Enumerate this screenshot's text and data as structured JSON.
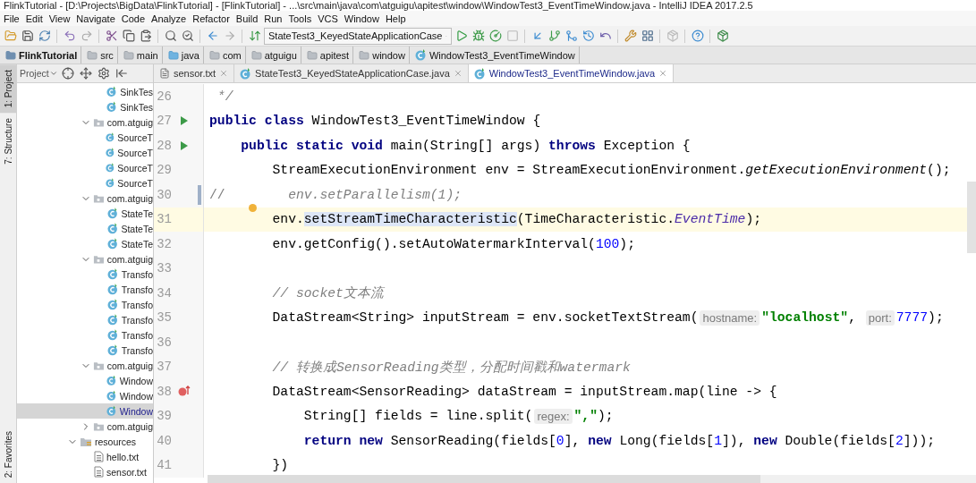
{
  "window": {
    "title": "FlinkTutorial - [D:\\Projects\\BigData\\FlinkTutorial] - [FlinkTutorial] - ...\\src\\main\\java\\com\\atguigu\\apitest\\window\\WindowTest3_EventTimeWindow.java - IntelliJ IDEA 2017.2.5"
  },
  "menu": [
    "File",
    "Edit",
    "View",
    "Navigate",
    "Code",
    "Analyze",
    "Refactor",
    "Build",
    "Run",
    "Tools",
    "VCS",
    "Window",
    "Help"
  ],
  "toolbar": {
    "run_config": "StateTest3_KeyedStateApplicationCase"
  },
  "breadcrumbs": [
    {
      "kind": "project",
      "label": "FlinkTutorial"
    },
    {
      "kind": "folder",
      "label": "src"
    },
    {
      "kind": "folder",
      "label": "main"
    },
    {
      "kind": "source",
      "label": "java"
    },
    {
      "kind": "package",
      "label": "com"
    },
    {
      "kind": "package",
      "label": "atguigu"
    },
    {
      "kind": "package",
      "label": "apitest"
    },
    {
      "kind": "package",
      "label": "window"
    },
    {
      "kind": "class",
      "label": "WindowTest3_EventTimeWindow"
    }
  ],
  "tool_tabs": {
    "top": [
      {
        "label": "1: Project",
        "selected": true
      },
      {
        "label": "7: Structure",
        "selected": false
      }
    ],
    "bottom": [
      {
        "label": "2: Favorites",
        "selected": false
      }
    ]
  },
  "project_panel": {
    "title": "Project"
  },
  "tree": [
    {
      "children": [
        {
          "children": [
            {
              "kind": "class",
              "label": "SinkTes",
              "selected": false
            },
            {
              "kind": "class",
              "label": "SinkTes",
              "selected": false
            }
          ]
        },
        {
          "kind": "package",
          "label": "com.atguig",
          "expanded": true,
          "selected": false,
          "children": [
            {
              "kind": "class",
              "label": "SourceT",
              "selected": false
            },
            {
              "kind": "class",
              "label": "SourceT",
              "selected": false
            },
            {
              "kind": "class",
              "label": "SourceT",
              "selected": false
            },
            {
              "kind": "class",
              "label": "SourceT",
              "selected": false
            }
          ]
        },
        {
          "kind": "package",
          "label": "com.atguig",
          "expanded": true,
          "selected": false,
          "children": [
            {
              "kind": "class",
              "label": "StateTe",
              "selected": false
            },
            {
              "kind": "class",
              "label": "StateTe",
              "selected": false
            },
            {
              "kind": "class",
              "label": "StateTe",
              "selected": false
            }
          ]
        },
        {
          "kind": "package",
          "label": "com.atguig",
          "expanded": true,
          "selected": false,
          "children": [
            {
              "kind": "class",
              "label": "Transfo",
              "selected": false
            },
            {
              "kind": "class",
              "label": "Transfo",
              "selected": false
            },
            {
              "kind": "class",
              "label": "Transfo",
              "selected": false
            },
            {
              "kind": "class",
              "label": "Transfo",
              "selected": false
            },
            {
              "kind": "class",
              "label": "Transfo",
              "selected": false
            },
            {
              "kind": "class",
              "label": "Transfo",
              "selected": false
            }
          ]
        },
        {
          "kind": "package",
          "label": "com.atguig",
          "expanded": true,
          "selected": false,
          "children": [
            {
              "kind": "class",
              "label": "Window",
              "selected": false
            },
            {
              "kind": "class",
              "label": "Window",
              "selected": false
            },
            {
              "kind": "class",
              "label": "Window",
              "selected": true
            }
          ]
        },
        {
          "kind": "package",
          "label": "com.atguig",
          "expanded": false,
          "selected": false
        }
      ]
    },
    {
      "kind": "resources",
      "label": "resources",
      "expanded": true,
      "selected": false,
      "children": [
        {
          "kind": "file",
          "label": "hello.txt",
          "selected": false
        },
        {
          "kind": "file",
          "label": "sensor.txt",
          "selected": false
        }
      ]
    }
  ],
  "tabs": [
    {
      "kind": "text",
      "label": "sensor.txt",
      "selected": false
    },
    {
      "kind": "class",
      "label": "StateTest3_KeyedStateApplicationCase.java",
      "selected": false
    },
    {
      "kind": "class",
      "label": "WindowTest3_EventTimeWindow.java",
      "selected": true
    }
  ],
  "code": [
    {
      "number": "26",
      "tokens": [
        {
          "kind": "comment",
          "text": " */"
        }
      ]
    },
    {
      "number": "27",
      "run_marker": true,
      "tokens": [
        {
          "kind": "keyword",
          "text": "public class"
        },
        {
          "kind": "plain",
          "text": " WindowTest3_EventTimeWindow {"
        }
      ]
    },
    {
      "number": "28",
      "run_marker": true,
      "tokens": [
        {
          "kind": "keyword",
          "text": "    public static void"
        },
        {
          "kind": "plain",
          "text": " main(String[] args) "
        },
        {
          "kind": "keyword",
          "text": "throws"
        },
        {
          "kind": "plain",
          "text": " Exception {"
        }
      ]
    },
    {
      "number": "29",
      "tokens": [
        {
          "kind": "plain",
          "text": "        StreamExecutionEnvironment env = StreamExecutionEnvironment."
        },
        {
          "kind": "static_call",
          "text": "getExecutionEnvironment"
        },
        {
          "kind": "plain",
          "text": "();"
        }
      ]
    },
    {
      "number": "30",
      "changed": true,
      "tokens": [
        {
          "kind": "comment_mark",
          "text": "//"
        },
        {
          "kind": "comment",
          "text": "        env.setParallelism(1);"
        }
      ]
    },
    {
      "number": "31",
      "current": true,
      "bulb": true,
      "tokens": [
        {
          "kind": "plain",
          "text": "        env."
        },
        {
          "kind": "usage",
          "text": "setStreamTimeCharacteristic"
        },
        {
          "kind": "plain",
          "text": "(TimeCharacteristic."
        },
        {
          "kind": "static_field",
          "text": "EventTime"
        },
        {
          "kind": "plain",
          "text": ");"
        }
      ]
    },
    {
      "number": "32",
      "tokens": [
        {
          "kind": "plain",
          "text": "        env.getConfig().setAutoWatermarkInterval("
        },
        {
          "kind": "number",
          "text": "100"
        },
        {
          "kind": "plain",
          "text": ");"
        }
      ]
    },
    {
      "number": "33"
    },
    {
      "number": "34",
      "tokens": [
        {
          "kind": "comment",
          "text": "        // socket文本流"
        }
      ]
    },
    {
      "number": "35",
      "tokens": [
        {
          "kind": "plain",
          "text": "        DataStream<String> inputStream = env.socketTextStream("
        },
        {
          "kind": "hint",
          "text": "hostname:"
        },
        {
          "kind": "string",
          "text": "\"localhost\""
        },
        {
          "kind": "plain",
          "text": ", "
        },
        {
          "kind": "hint",
          "text": "port:"
        },
        {
          "kind": "number",
          "text": "7777"
        },
        {
          "kind": "plain",
          "text": ");"
        }
      ]
    },
    {
      "number": "36"
    },
    {
      "number": "37",
      "tokens": [
        {
          "kind": "comment",
          "text": "        // 转换成SensorReading类型，分配时间戳和watermark"
        }
      ]
    },
    {
      "number": "38",
      "lambda_marker": true,
      "tokens": [
        {
          "kind": "plain",
          "text": "        DataStream<SensorReading> dataStream = inputStream.map(line -> {"
        }
      ]
    },
    {
      "number": "39",
      "tokens": [
        {
          "kind": "plain",
          "text": "            String[] fields = line.split("
        },
        {
          "kind": "hint",
          "text": "regex:"
        },
        {
          "kind": "string",
          "text": "\",\""
        },
        {
          "kind": "plain",
          "text": ");"
        }
      ]
    },
    {
      "number": "40",
      "tokens": [
        {
          "kind": "keyword",
          "text": "            return new"
        },
        {
          "kind": "plain",
          "text": " SensorReading(fields["
        },
        {
          "kind": "number",
          "text": "0"
        },
        {
          "kind": "plain",
          "text": "], "
        },
        {
          "kind": "keyword",
          "text": "new"
        },
        {
          "kind": "plain",
          "text": " Long(fields["
        },
        {
          "kind": "number",
          "text": "1"
        },
        {
          "kind": "plain",
          "text": "]), "
        },
        {
          "kind": "keyword",
          "text": "new"
        },
        {
          "kind": "plain",
          "text": " Double(fields["
        },
        {
          "kind": "number",
          "text": "2"
        },
        {
          "kind": "plain",
          "text": "]));"
        }
      ]
    },
    {
      "number": "41",
      "tokens": [
        {
          "kind": "plain",
          "text": "        })"
        }
      ]
    }
  ]
}
